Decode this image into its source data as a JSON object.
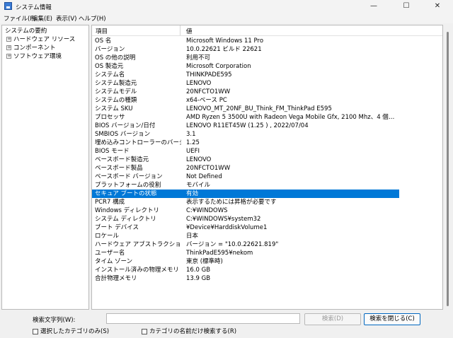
{
  "window": {
    "title": "システム情報",
    "minimize": "—",
    "maximize": "☐",
    "close": "✕"
  },
  "menu": [
    "ファイル(F)",
    "編集(E)",
    "表示(V)",
    "ヘルプ(H)"
  ],
  "tree": [
    {
      "label": "システムの要約",
      "expandable": false
    },
    {
      "label": "ハードウェア リソース",
      "expandable": true
    },
    {
      "label": "コンポーネント",
      "expandable": true
    },
    {
      "label": "ソフトウェア環境",
      "expandable": true
    }
  ],
  "table": {
    "headers": {
      "item": "項目",
      "value": "値"
    },
    "selected_index": 19,
    "rows": [
      {
        "item": "OS 名",
        "value": "Microsoft Windows 11 Pro"
      },
      {
        "item": "バージョン",
        "value": "10.0.22621 ビルド 22621"
      },
      {
        "item": "OS の他の説明",
        "value": "利用不可"
      },
      {
        "item": "OS 製造元",
        "value": "Microsoft Corporation"
      },
      {
        "item": "システム名",
        "value": "THINKPADE595"
      },
      {
        "item": "システム製造元",
        "value": "LENOVO"
      },
      {
        "item": "システムモデル",
        "value": "20NFCTO1WW"
      },
      {
        "item": "システムの種類",
        "value": "x64-ベース PC"
      },
      {
        "item": "システム SKU",
        "value": "LENOVO_MT_20NF_BU_Think_FM_ThinkPad E595"
      },
      {
        "item": "プロセッサ",
        "value": "AMD Ryzen 5 3500U with Radeon Vega Mobile Gfx, 2100 Mhz、4 個のコア、8 ..."
      },
      {
        "item": "BIOS バージョン/日付",
        "value": "LENOVO R11ET45W (1.25 ) , 2022/07/04"
      },
      {
        "item": "SMBIOS バージョン",
        "value": "3.1"
      },
      {
        "item": "埋め込みコントローラーのバージョン",
        "value": "1.25"
      },
      {
        "item": "BIOS モード",
        "value": "UEFI"
      },
      {
        "item": "ベースボード製造元",
        "value": "LENOVO"
      },
      {
        "item": "ベースボード製品",
        "value": "20NFCTO1WW"
      },
      {
        "item": "ベースボード バージョン",
        "value": "Not Defined"
      },
      {
        "item": "プラットフォームの役割",
        "value": "モバイル"
      },
      {
        "item": "セキュア ブートの状態",
        "value": "有効"
      },
      {
        "item": "PCR7 構成",
        "value": "表示するためには昇格が必要です"
      },
      {
        "item": "Windows ディレクトリ",
        "value": "C:¥WINDOWS"
      },
      {
        "item": "システム ディレクトリ",
        "value": "C:¥WINDOWS¥system32"
      },
      {
        "item": "ブート デバイス",
        "value": "¥Device¥HarddiskVolume1"
      },
      {
        "item": "ロケール",
        "value": "日本"
      },
      {
        "item": "ハードウェア アブストラクション レイヤー",
        "value": "バージョン = \"10.0.22621.819\""
      },
      {
        "item": "ユーザー名",
        "value": "ThinkPadE595¥nekom"
      },
      {
        "item": "タイム ゾーン",
        "value": "東京 (標準時)"
      },
      {
        "item": "インストール済みの物理メモリ (RAM)",
        "value": "16.0 GB"
      },
      {
        "item": "合計物理メモリ",
        "value": "13.9 GB"
      }
    ]
  },
  "find": {
    "label": "検索文字列(W):",
    "value": "",
    "search_button": "検索(D)",
    "close_button": "検索を閉じる(C)",
    "option_selected_only": "選択したカテゴリのみ(S)",
    "option_names_only": "カテゴリの名前だけ検索する(R)"
  }
}
